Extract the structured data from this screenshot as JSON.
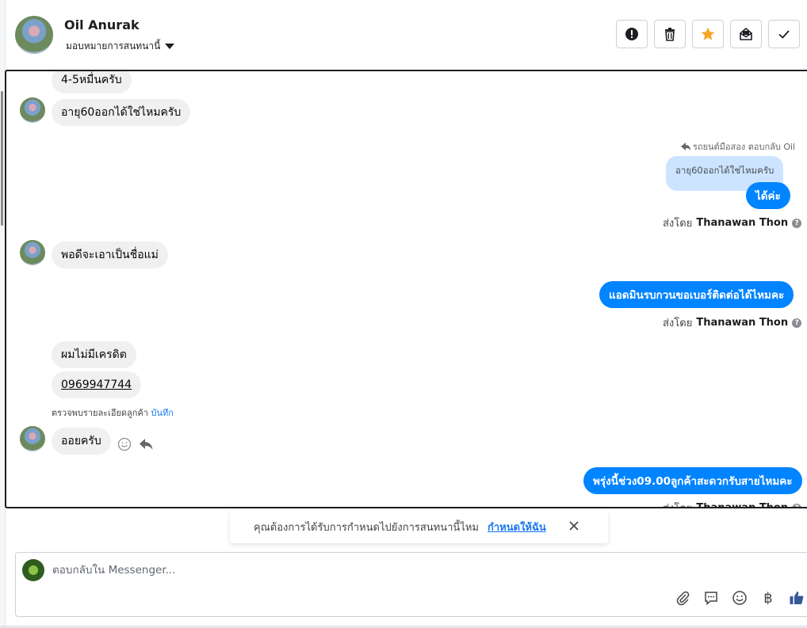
{
  "header": {
    "contact_name": "Oil Anurak",
    "assign_label": "มอบหมายการสนทนานี้",
    "toolbar": [
      {
        "icon": "alert-icon",
        "color": "#1c1e21"
      },
      {
        "icon": "trash-icon",
        "color": "#1c1e21"
      },
      {
        "icon": "star-icon",
        "color": "#f5a623"
      },
      {
        "icon": "mark-unread-icon",
        "color": "#1c1e21"
      },
      {
        "icon": "check-icon",
        "color": "#1c1e21"
      }
    ]
  },
  "messages": {
    "in_1": "4-5หมื่นครับ",
    "in_2": "อายุ60ออกได้ใช่ไหมครับ",
    "reply_context": "รถยนต์มือสอง ตอบกลับ Oil",
    "quoted_text": "อายุ60ออกได้ใช่ไหมครับ",
    "out_1": "ได้ค่ะ",
    "sent_by_label": "ส่งโดย",
    "sent_by_name": "Thanawan Thon",
    "in_3": "พอดีจะเอาเป็นชื่อแม่",
    "out_2": "แอดมินรบกวนขอเบอร์ติดต่อได้ไหมคะ",
    "in_4": "ผมไม่มีเครดิต",
    "in_5": "0969947744",
    "detail_text": "ตรวจพบรายละเอียดลูกค้า",
    "detail_link": "บันทึก",
    "in_6": "ออยครับ",
    "out_3": "พรุ่งนี้ช่วง09.00ลูกค้าสะดวกรับสายไหมคะ"
  },
  "notice": {
    "text": "คุณต้องการได้รับการกำหนดไปยังการสนทนานี้ไหม",
    "link": "กำหนดให้ฉัน"
  },
  "composer": {
    "placeholder": "ตอบกลับใน Messenger..."
  },
  "colors": {
    "accent": "#0084ff",
    "link": "#1877f2"
  }
}
